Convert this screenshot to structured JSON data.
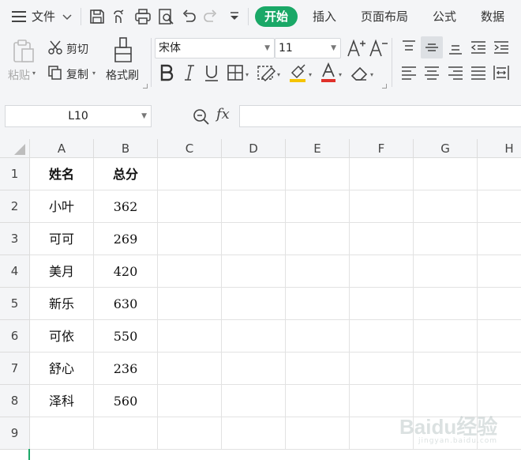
{
  "menubar": {
    "file_label": "文件",
    "tabs": [
      "开始",
      "插入",
      "页面布局",
      "公式",
      "数据"
    ]
  },
  "ribbon": {
    "paste_label": "粘贴",
    "cut_label": "剪切",
    "copy_label": "复制",
    "format_painter_label": "格式刷",
    "font_name": "宋体",
    "font_size": "11"
  },
  "formula_bar": {
    "name_box": "L10",
    "fx_label": "fx",
    "content": ""
  },
  "sheet": {
    "columns": [
      "A",
      "B",
      "C",
      "D",
      "E",
      "F",
      "G",
      "H"
    ],
    "rows": [
      "1",
      "2",
      "3",
      "4",
      "5",
      "6",
      "7",
      "8",
      "9"
    ],
    "data": [
      [
        "姓名",
        "总分"
      ],
      [
        "小叶",
        "362"
      ],
      [
        "可可",
        "269"
      ],
      [
        "美月",
        "420"
      ],
      [
        "新乐",
        "630"
      ],
      [
        "可依",
        "550"
      ],
      [
        "舒心",
        "236"
      ],
      [
        "泽科",
        "560"
      ],
      [
        "",
        ""
      ]
    ]
  },
  "watermark": {
    "brand": "Baidu经验",
    "url": "jingyan.baidu.com"
  },
  "colors": {
    "accent": "#1aa867",
    "chrome_bg": "#f4f5f7",
    "font_color_underline": "#e0302a",
    "highlight_underline": "#f5c400"
  }
}
